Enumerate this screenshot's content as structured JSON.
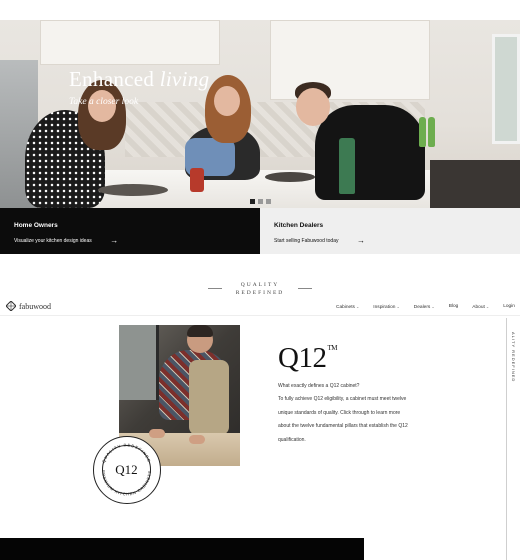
{
  "hero": {
    "title_main": "Enhanced",
    "title_italic": "living",
    "subtitle": "Take a closer look",
    "slides": 3,
    "active_slide": 1
  },
  "cta": {
    "home": {
      "title": "Home Owners",
      "subtitle": "Visualize your kitchen design ideas",
      "arrow": "→"
    },
    "dealers": {
      "title": "Kitchen Dealers",
      "subtitle": "Start selling Fabuwood today",
      "arrow": "→"
    }
  },
  "quality": {
    "line1": "QUALITY",
    "line2": "REDEFINED"
  },
  "nav": {
    "logo_text": "fabuwood",
    "items": [
      {
        "label": "Cabinets",
        "chevron": "⌄"
      },
      {
        "label": "Inspiration",
        "chevron": "⌄"
      },
      {
        "label": "Dealers",
        "chevron": "⌄"
      },
      {
        "label": "Blog",
        "chevron": ""
      },
      {
        "label": "About",
        "chevron": "⌄"
      },
      {
        "label": "Login",
        "chevron": ""
      }
    ]
  },
  "side_tab": {
    "label": "ALITY REDEFINED"
  },
  "q12": {
    "title": "Q12",
    "tm": "TM",
    "question": "What exactly defines a Q12 cabinet?",
    "body": "To fully achieve Q12 eligibility, a cabinet must meet twelve unique standards of quality. Click through to learn more about the twelve fundamental pillars that establish the Q12 qualification.",
    "seal_center": "Q12",
    "seal_top": "QUALITY REDEFINED",
    "seal_bottom": "PREMIUM KITCHEN CABINETS"
  },
  "colors": {
    "dark": "#0c0c0c",
    "light_panel": "#efefef",
    "accent_text": "#111111"
  }
}
